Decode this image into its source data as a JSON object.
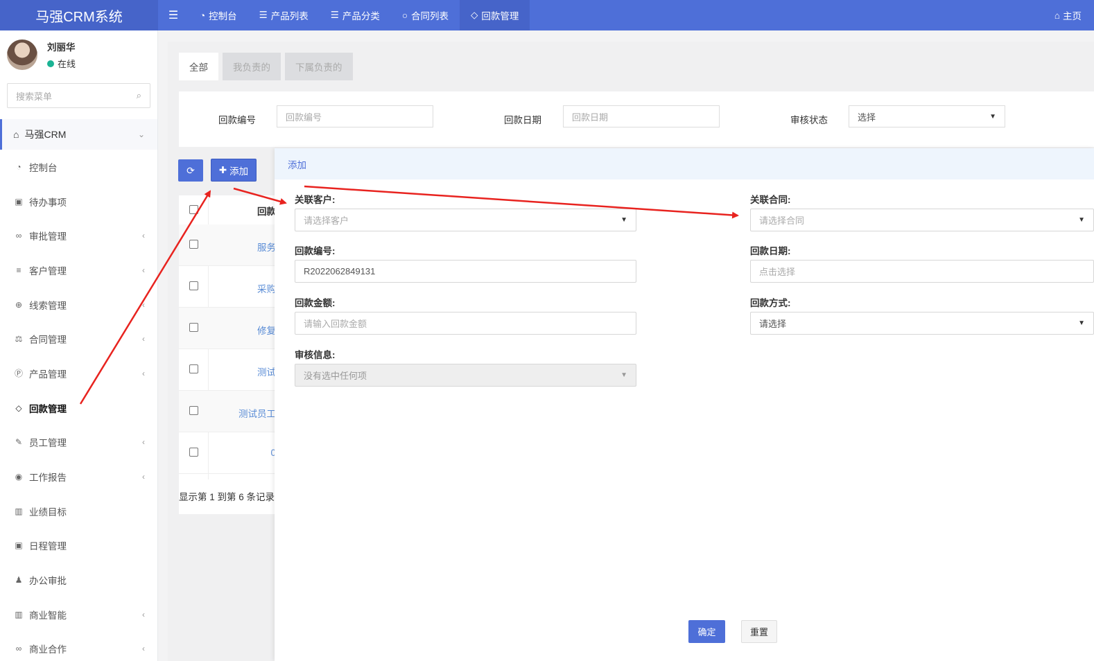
{
  "app": {
    "title": "马强CRM系统"
  },
  "topnav": {
    "items": [
      {
        "label": "控制台",
        "icon": "dashboard-icon"
      },
      {
        "label": "产品列表",
        "icon": "list-icon"
      },
      {
        "label": "产品分类",
        "icon": "list-icon"
      },
      {
        "label": "合同列表",
        "icon": "circle-icon"
      },
      {
        "label": "回款管理",
        "icon": "diamond-icon"
      }
    ],
    "home_label": "主页"
  },
  "user": {
    "name": "刘丽华",
    "status": "在线"
  },
  "sidebar": {
    "search_placeholder": "搜索菜单",
    "head": "马强CRM",
    "items": [
      {
        "label": "控制台",
        "icon": "dashboard-icon"
      },
      {
        "label": "待办事项",
        "icon": "calendar-check-icon"
      },
      {
        "label": "审批管理",
        "icon": "handshake-icon"
      },
      {
        "label": "客户管理",
        "icon": "sliders-icon"
      },
      {
        "label": "线索管理",
        "icon": "search-plus-icon"
      },
      {
        "label": "合同管理",
        "icon": "balance-scale-icon"
      },
      {
        "label": "产品管理",
        "icon": "product-p-icon"
      },
      {
        "label": "回款管理",
        "icon": "diamond-icon"
      },
      {
        "label": "员工管理",
        "icon": "brush-icon"
      },
      {
        "label": "工作报告",
        "icon": "rebel-icon"
      },
      {
        "label": "业绩目标",
        "icon": "bar-chart-icon"
      },
      {
        "label": "日程管理",
        "icon": "calendar-times-icon"
      },
      {
        "label": "办公审批",
        "icon": "user-tie-icon"
      },
      {
        "label": "商业智能",
        "icon": "bar-chart-icon"
      },
      {
        "label": "商业合作",
        "icon": "handshake-icon"
      }
    ]
  },
  "tabs": [
    "全部",
    "我负责的",
    "下属负责的"
  ],
  "filter": {
    "no_label": "回款编号",
    "no_placeholder": "回款编号",
    "date_label": "回款日期",
    "date_placeholder": "回款日期",
    "status_label": "审核状态",
    "status_value": "选择"
  },
  "toolbar": {
    "add_label": "添加"
  },
  "table": {
    "header": "回款",
    "rows": [
      "服务",
      "采购",
      "修复",
      "测试",
      "测试员工",
      "0"
    ],
    "page_info": "显示第 1 到第 6 条记录"
  },
  "modal": {
    "title": "添加",
    "customer_label": "关联客户:",
    "customer_placeholder": "请选择客户",
    "contract_label": "关联合同:",
    "contract_placeholder": "请选择合同",
    "no_label": "回款编号:",
    "no_value": "R2022062849131",
    "date_label": "回款日期:",
    "date_placeholder": "点击选择",
    "amount_label": "回款金额:",
    "amount_placeholder": "请输入回款金额",
    "method_label": "回款方式:",
    "method_value": "请选择",
    "audit_label": "审核信息:",
    "audit_value": "没有选中任何项",
    "ok_label": "确定",
    "reset_label": "重置"
  },
  "colors": {
    "primary": "#4e6fd8",
    "online": "#1ab394",
    "arrow": "#e8231f"
  }
}
